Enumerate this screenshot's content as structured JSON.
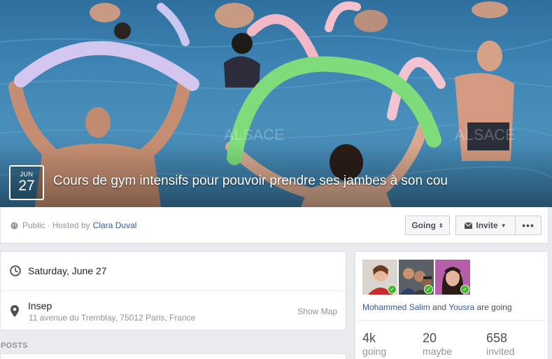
{
  "event": {
    "month": "JUN",
    "day": "27",
    "title": "Cours de gym intensifs pour pouvoir prendre ses jambes à son cou",
    "cover_watermark": "ALSACE"
  },
  "header": {
    "privacy": "Public",
    "hosted_by_label": "Hosted by",
    "host_name": "Clara Duval",
    "going_button": "Going",
    "invite_button": "Invite",
    "more_button": "•••"
  },
  "details": {
    "date": "Saturday, June 27",
    "place_name": "Insep",
    "place_address": "11 avenue du Tremblay, 75012 Paris, France",
    "show_map": "Show Map"
  },
  "posts": {
    "label": "POSTS"
  },
  "attendance": {
    "friend1": "Mohammed Salim",
    "connector": "and",
    "friend2": "Yousra",
    "suffix": "are going",
    "stats": [
      {
        "num": "4k",
        "label": "going"
      },
      {
        "num": "20",
        "label": "maybe"
      },
      {
        "num": "658",
        "label": "invited"
      }
    ]
  },
  "colors": {
    "link": "#365899",
    "check_green": "#42b72a",
    "muted": "#90949c"
  }
}
